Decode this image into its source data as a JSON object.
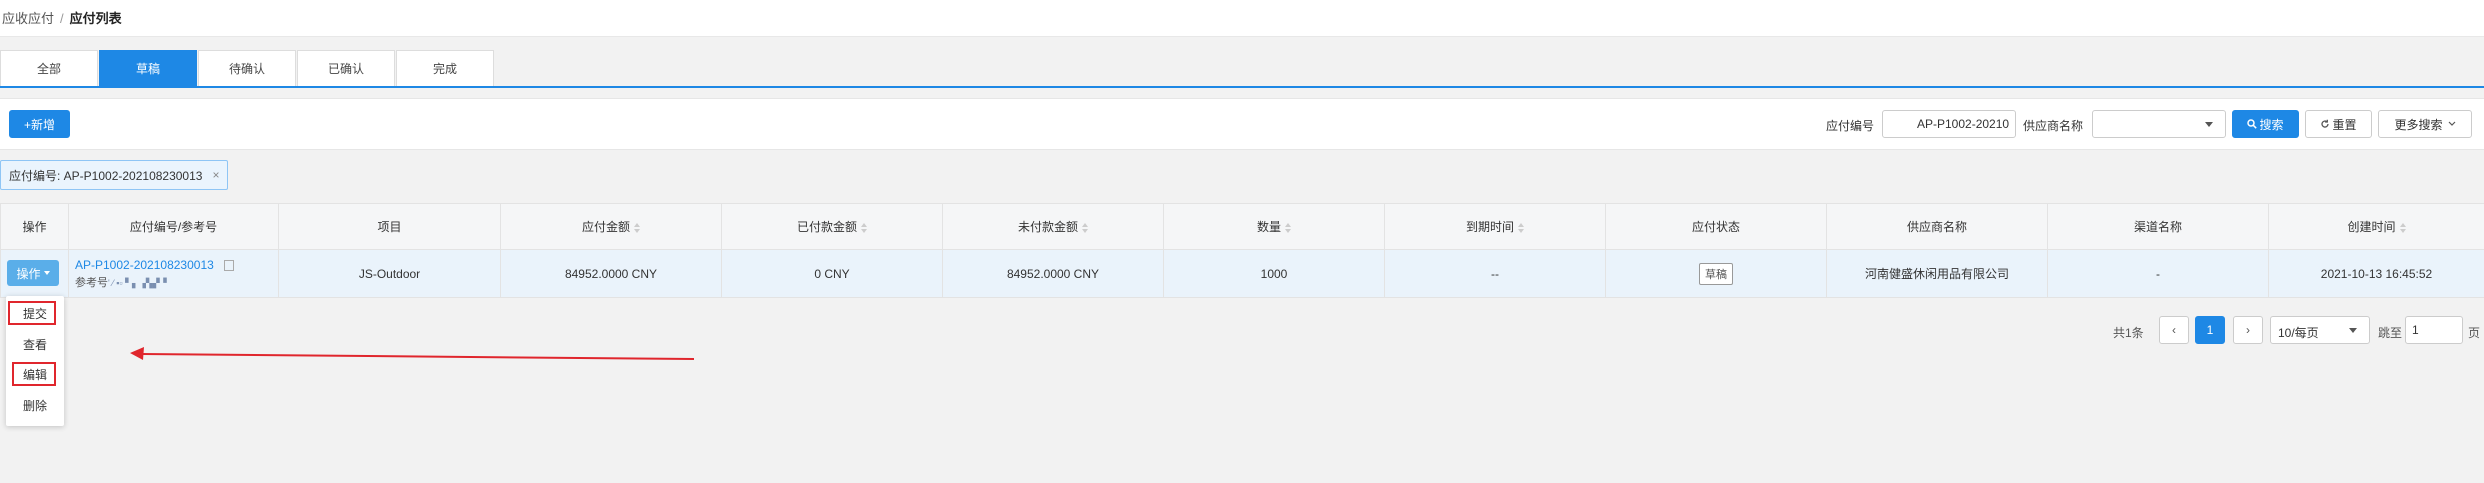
{
  "breadcrumb": {
    "parent": "应收应付",
    "separator": "/",
    "current": "应付列表"
  },
  "tabs": [
    {
      "label": "全部",
      "active": false
    },
    {
      "label": "草稿",
      "active": true
    },
    {
      "label": "待确认",
      "active": false
    },
    {
      "label": "已确认",
      "active": false
    },
    {
      "label": "完成",
      "active": false
    }
  ],
  "toolbar": {
    "add_label": "+新增",
    "payable_no_label": "应付编号",
    "payable_no_value": "AP-P1002-20210",
    "supplier_label": "供应商名称",
    "supplier_value": "",
    "search_label": "搜索",
    "reset_label": "重置",
    "more_label": "更多搜索"
  },
  "filter_tag": {
    "text": "应付编号: AP-P1002-202108230013",
    "close": "×"
  },
  "table": {
    "headers": [
      "操作",
      "应付编号/参考号",
      "项目",
      "应付金额",
      "已付款金额",
      "未付款金额",
      "数量",
      "到期时间",
      "应付状态",
      "供应商名称",
      "渠道名称",
      "创建时间"
    ],
    "row": {
      "action": "操作",
      "code": "AP-P1002-202108230013",
      "ref_label": "参考号",
      "ref_value": "' ⁄ ▪▫ ▘▖▗▚▞▝",
      "project": "JS-Outdoor",
      "amount": "84952.0000 CNY",
      "paid": "0 CNY",
      "unpaid": "84952.0000 CNY",
      "qty": "1000",
      "due": "--",
      "status": "草稿",
      "supplier": "河南健盛休闲用品有限公司",
      "channel": "-",
      "created": "2021-10-13 16:45:52"
    }
  },
  "action_menu": [
    "提交",
    "查看",
    "编辑",
    "删除"
  ],
  "pagination": {
    "total": "共1条",
    "prev": "‹",
    "current": "1",
    "next": "›",
    "page_size": "10/每页",
    "goto_label": "跳至",
    "goto_value": "1",
    "page_suffix": "页"
  },
  "colors": {
    "accent": "#1e88e5",
    "annotation": "#e0262d"
  }
}
